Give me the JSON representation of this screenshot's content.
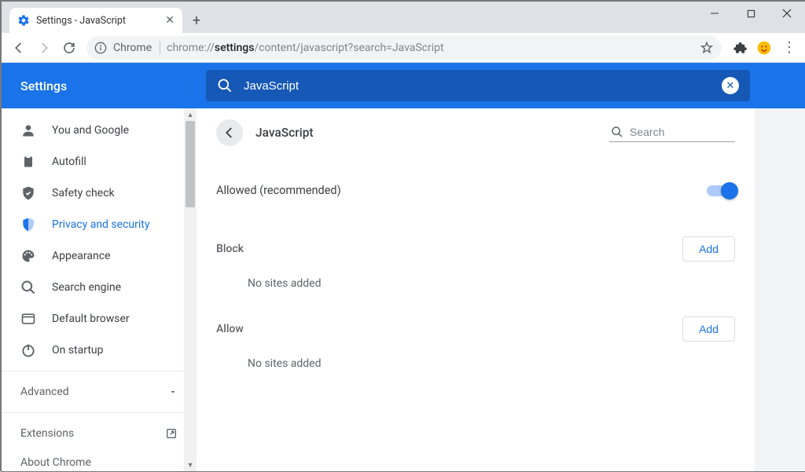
{
  "window": {
    "tab_title": "Settings - JavaScript"
  },
  "omnibox": {
    "chrome_label": "Chrome",
    "url_prefix": "chrome://",
    "url_bold": "settings",
    "url_rest": "/content/javascript?search=JavaScript"
  },
  "header": {
    "title": "Settings",
    "search_value": "JavaScript"
  },
  "sidebar": {
    "items": [
      {
        "label": "You and Google"
      },
      {
        "label": "Autofill"
      },
      {
        "label": "Safety check"
      },
      {
        "label": "Privacy and security"
      },
      {
        "label": "Appearance"
      },
      {
        "label": "Search engine"
      },
      {
        "label": "Default browser"
      },
      {
        "label": "On startup"
      }
    ],
    "advanced": "Advanced",
    "extensions": "Extensions",
    "about": "About Chrome"
  },
  "page": {
    "title": "JavaScript",
    "search_placeholder": "Search",
    "allowed_label": "Allowed (recommended)",
    "block_label": "Block",
    "allow_label": "Allow",
    "add_label": "Add",
    "no_sites": "No sites added"
  }
}
